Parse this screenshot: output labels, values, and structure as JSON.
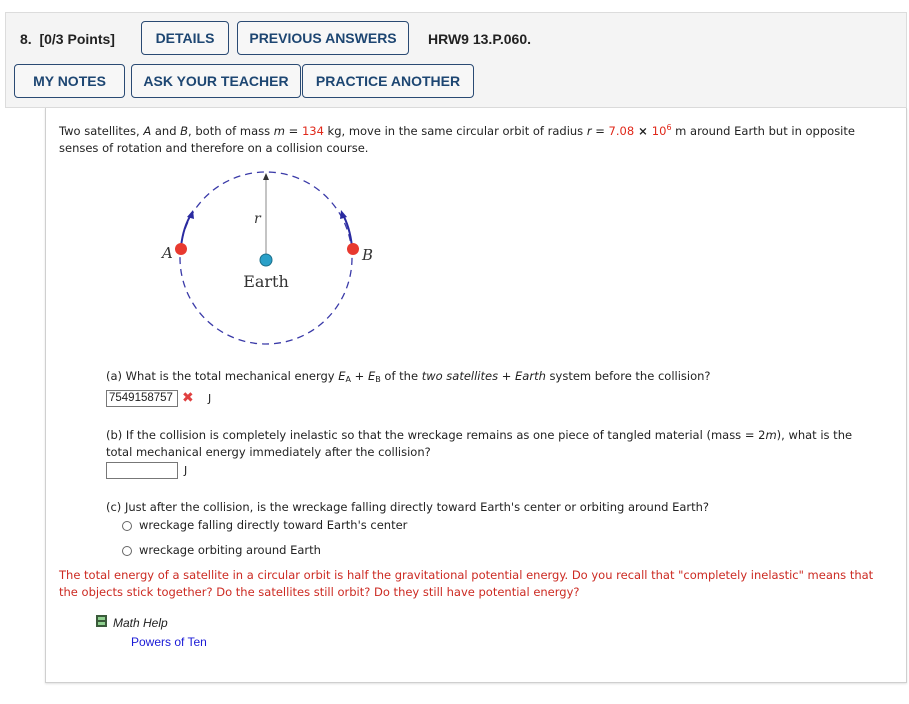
{
  "header": {
    "number": "8.",
    "points": "[0/3 Points]",
    "buttons": {
      "details": "DETAILS",
      "previous_answers": "PREVIOUS ANSWERS",
      "my_notes": "MY NOTES",
      "ask_teacher": "ASK YOUR TEACHER",
      "practice_another": "PRACTICE ANOTHER"
    },
    "problem_code": "HRW9 13.P.060."
  },
  "problem": {
    "p1": "Two satellites, ",
    "A": "A",
    "p2": " and ",
    "B": "B",
    "p3": ", both of mass ",
    "m": "m",
    "eq": " = ",
    "mass_value": "134",
    "p4": " kg, move in the same circular orbit of radius ",
    "r": "r",
    "eq2": " = ",
    "radius_mantissa": "7.08",
    "times": " × ",
    "radius_base": "10",
    "radius_exp": "6",
    "p5": " m around Earth but in opposite",
    "line2": "senses of rotation and therefore on a collision course."
  },
  "figure": {
    "label_A": "A",
    "label_B": "B",
    "label_r": "r",
    "label_earth": "Earth",
    "colors": {
      "orbit": "#3a3aa8",
      "satellite": "#e8392f",
      "earth": "#2aa0c8"
    }
  },
  "part_a": {
    "q1": "(a) What is the total mechanical energy ",
    "EA": "E",
    "EA_sub": "A",
    "plus": " + ",
    "EB": "E",
    "EB_sub": "B",
    "q2": " of the ",
    "two_sat": "two satellites",
    "plus2": " + ",
    "earth": "Earth",
    "q3": " system before the collision?",
    "answer_value": "7549158757",
    "status": "incorrect",
    "unit": "J"
  },
  "part_b": {
    "q1": "(b) If the collision is completely inelastic so that the wreckage remains as one piece of tangled material (mass = 2",
    "m": "m",
    "q2": "), what is the",
    "q3": "total mechanical energy immediately after the collision?",
    "answer_value": "",
    "unit": "J"
  },
  "part_c": {
    "question": "(c) Just after the collision, is the wreckage falling directly toward Earth's center or orbiting around Earth?",
    "options": [
      "wreckage falling directly toward Earth's center",
      "wreckage orbiting around Earth"
    ],
    "selected": null
  },
  "hint": {
    "line1": "The total energy of a satellite in a circular orbit is half the gravitational potential energy. Do you recall that \"completely inelastic\" means that",
    "line2": "the objects stick together? Do the satellites still orbit? Do they still have potential energy?"
  },
  "math_help": {
    "title": "Math Help",
    "link": "Powers of Ten"
  }
}
